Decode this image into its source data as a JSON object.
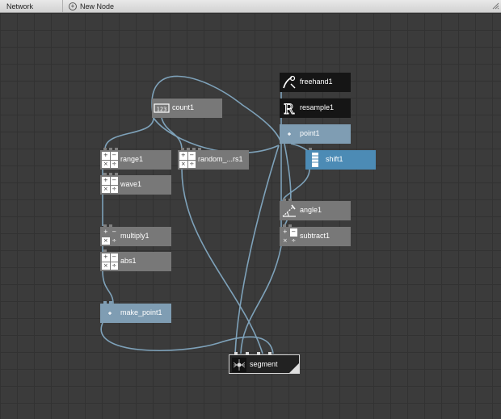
{
  "topbar": {
    "title": "Network",
    "new_node_label": "New Node"
  },
  "nodes": {
    "count": "count1",
    "freehand": "freehand1",
    "resample": "resample1",
    "point": "point1",
    "shift": "shift1",
    "range": "range1",
    "random": "random_...rs1",
    "wave": "wave1",
    "angle": "angle1",
    "subtract": "subtract1",
    "multiply": "multiply1",
    "abs": "abs1",
    "make_point": "make_point1",
    "segment": "segment"
  },
  "icons": {
    "count": "counter-icon",
    "freehand": "freehand-pen-icon",
    "resample": "resample-icon",
    "point": "point-icon",
    "shift": "shift-icon",
    "math": "math-operators-icon",
    "angle": "angle-icon",
    "segment": "segment-icon"
  },
  "colors": {
    "canvas": "#3b3b3b",
    "wire": "#7ea2ba",
    "node_gray": "#787878",
    "node_light": "#7f9db3",
    "node_selected": "#4c8bb5",
    "node_dark": "#151515"
  }
}
